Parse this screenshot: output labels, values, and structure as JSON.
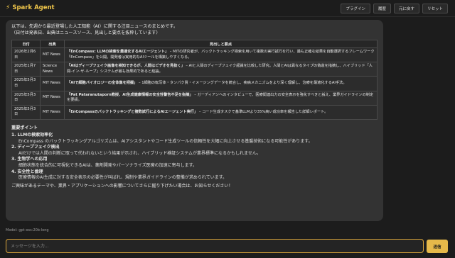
{
  "app": {
    "title": "Spark Agent",
    "brand_icon": "bolt-icon",
    "brand_color": "#f2c84b"
  },
  "toolbar": {
    "plugins": "プラグイン",
    "history": "履歴",
    "undo": "元に戻す",
    "reset": "リセット"
  },
  "message": {
    "intro": [
      "以下は、先週から最近登場した人工知能（AI）に関する注目ニュースのまとめです。",
      "（日付は発表日、出典はニュースソース、見出しと要点を抜粋しています）"
    ],
    "table": {
      "headers": [
        "日付",
        "出典",
        "見出しと要点"
      ],
      "rows": [
        {
          "date": "2026年2月6日",
          "source": "MIT News",
          "headline": "「EnCompass: LLMの検索を最適化するAIエージェント」",
          "summary": " – MITの研究者が、バックトラッキング検索を用いて複数の実行試行を行い、最も正確な結果を自動選択するフレームワーク「EnCompass」を公開。開発者は実用的なAIツールを構築しやすくなる。"
        },
        {
          "date": "2025年1月7日",
          "source": "Science News",
          "headline": "「AIはディープフェイク画像を検知できるが、人間はビデオを見抜く」",
          "summary": " – AIと人間のディープフェイク認識を比較した研究。人間とAIは異なるタイプの偽造を指摘し、ハイブリッド「人間-イン-ザ-ループ」システムが最も効果的であると結論。"
        },
        {
          "date": "2025年5月3日",
          "source": "MIT News",
          "headline": "「AIで細胞バイオロジーの全体像を把握」",
          "summary": " – 1細胞の転写体・タンパク質・イメージングデータを統合し、疾病メカニズムをより深く理解し、治療を最適化するAI手法。"
        },
        {
          "date": "2025年5月3日",
          "source": "MIT News",
          "headline": "「Pat Pataranutaporn教授、AI生成健康情報の安全性警告不足を指摘」",
          "summary": " – ガーディアンへのインタビューで、医療関連出力の安全表示を強化すべきと訴え、業界ガイドラインの制定を要請。"
        },
        {
          "date": "2025年5月3日",
          "source": "MIT News",
          "headline": "「EnCompassのバックトラッキングと複数試行によるAIエージェント実行」",
          "summary": " – コード生成タスクで基準LLMより35%高い成功率を報告した詳細レポート。"
        }
      ]
    },
    "points_title": "重要ポイント",
    "points": [
      {
        "title": "1. LLMの検索効率化",
        "desc": "EnCompass のバックトラッキングアルゴリズムは、AIアシスタントやコード生成ツールの信頼性を大幅に向上させる基盤技術になる可能性があります。"
      },
      {
        "title": "2. ディープフェイク検出",
        "desc": "AIだけでは人間の判断に取って代われないという結果が示され、ハイブリッド検証システムが業界標準になるかもしれません。"
      },
      {
        "title": "3. 生物学への応用",
        "desc": "細胞状態を統合的に可視化できるAIは、薬剤開発やパーソナライズ医療の加速に寄与します。"
      },
      {
        "title": "4. 安全性と倫理",
        "desc": "医療情報のAI生成に対する安全表示の必要性が叫ばれ、規制や業界ガイドラインの整備が求められています。"
      }
    ],
    "closing": "ご興味があるテーマや、業界・アプリケーションへの影響についてさらに掘り下げたい場合は、お知らせください！"
  },
  "model_label": "Model: gpt-oss:20b-long",
  "composer": {
    "placeholder": "メッセージを入力...",
    "send": "送信",
    "accent": "#e6b94a"
  }
}
